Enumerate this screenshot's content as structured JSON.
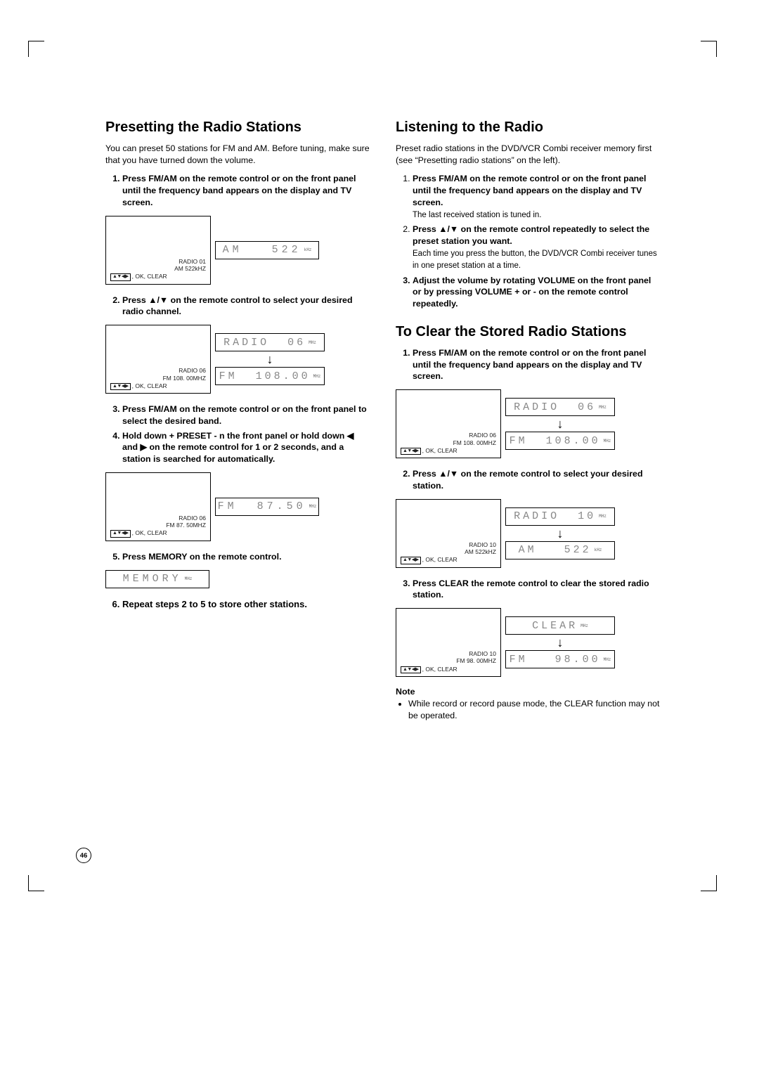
{
  "page_number": "46",
  "left": {
    "h1": "Presetting the Radio Stations",
    "intro": "You can preset 50 stations for FM and AM. Before tuning, make sure that you have turned down the volume.",
    "step1": "Press FM/AM on the remote control or on the front panel until the frequency band appears on the display and TV screen.",
    "fig1_tv_line1": "RADIO   01",
    "fig1_tv_line2": "AM   522kHZ",
    "fig1_tv_nav": "▲▼◀▶",
    "fig1_tv_line3": ", OK, CLEAR",
    "fig1_lcd": "AM   522",
    "fig1_lcd_unit": "kHz",
    "step2_prefix": "Press ",
    "step2_mid": " on the remote control to select your desired radio channel.",
    "arrow_updown": "▲/▼",
    "fig2_tv_line1": "RADIO   06",
    "fig2_tv_line2": "FM   108. 00MHZ",
    "fig2_tv_nav": "▲▼◀▶",
    "fig2_tv_line3": ", OK, CLEAR",
    "fig2_lcd_top": "RADIO  06",
    "fig2_lcd_top_unit": "MHz",
    "fig2_lcd_bot": "FM  108.00",
    "fig2_lcd_bot_unit": "MHz",
    "step3": "Press FM/AM on the remote control or on the front panel to select the desired band.",
    "step4_prefix": "Hold down + PRESET - n the front panel or hold down ",
    "step4_left": "◀",
    "step4_and": " and ",
    "step4_right": "▶",
    "step4_suffix": "  on the remote control for 1 or 2 seconds, and a station is searched for automatically.",
    "fig3_tv_line1": "RADIO   06",
    "fig3_tv_line2": "FM   87. 50MHZ",
    "fig3_tv_nav": "▲▼◀▶",
    "fig3_tv_line3": ", OK, CLEAR",
    "fig3_lcd": "FM  87.50",
    "fig3_lcd_unit": "MHz",
    "step5": "Press MEMORY on the remote control.",
    "fig4_lcd": "MEMORY",
    "fig4_lcd_unit": "MHz",
    "step6": "Repeat steps 2 to 5 to store other stations."
  },
  "right": {
    "h1a": "Listening to the Radio",
    "introA": "Preset radio stations in the DVD/VCR Combi receiver memory first (see “Presetting radio stations” on the left).",
    "a_step1": "Press FM/AM on the remote control or on the front panel until the frequency band appears on the display and TV screen.",
    "a_step1_after": "The last received station is tuned in.",
    "a_step2_prefix": "Press ",
    "arrow_updown": "▲/▼",
    "a_step2_mid": " on the remote control repeatedly to select the preset station you want.",
    "a_step2_after": "Each time you press the button, the DVD/VCR Combi receiver tunes in one preset station at a time.",
    "a_step3": "Adjust the volume by rotating VOLUME on the front panel or by pressing VOLUME + or - on the remote control repeatedly.",
    "h1b": "To Clear the Stored Radio Stations",
    "b_step1": "Press FM/AM on the remote control or on the front panel until the frequency band appears on the display and TV screen.",
    "figB1_tv_line1": "RADIO   06",
    "figB1_tv_line2": "FM   108. 00MHZ",
    "figB1_tv_nav": "▲▼◀▶",
    "figB1_tv_line3": ", OK, CLEAR",
    "figB1_lcd_top": "RADIO  06",
    "figB1_lcd_top_unit": "MHz",
    "figB1_lcd_bot": "FM  108.00",
    "figB1_lcd_bot_unit": "MHz",
    "b_step2_prefix": "Press ",
    "b_step2_mid": " on the remote control to select your desired station.",
    "figB2_tv_line1": "RADIO   10",
    "figB2_tv_line2": "AM   522kHZ",
    "figB2_tv_nav": "▲▼◀▶",
    "figB2_tv_line3": ", OK, CLEAR",
    "figB2_lcd_top": "RADIO  10",
    "figB2_lcd_top_unit": "MHz",
    "figB2_lcd_bot": "AM   522",
    "figB2_lcd_bot_unit": "kHz",
    "b_step3": "Press CLEAR the remote control to clear the stored radio station.",
    "figB3_tv_line1": "RADIO   10",
    "figB3_tv_line2": "FM   98. 00MHZ",
    "figB3_tv_nav": "▲▼◀▶",
    "figB3_tv_line3": ", OK, CLEAR",
    "figB3_lcd_top": "CLEAR",
    "figB3_lcd_top_unit": "MHz",
    "figB3_lcd_bot": "FM   98.00",
    "figB3_lcd_bot_unit": "MHz",
    "note_head": "Note",
    "note_item": "While record or record pause mode, the CLEAR function may not be operated."
  }
}
